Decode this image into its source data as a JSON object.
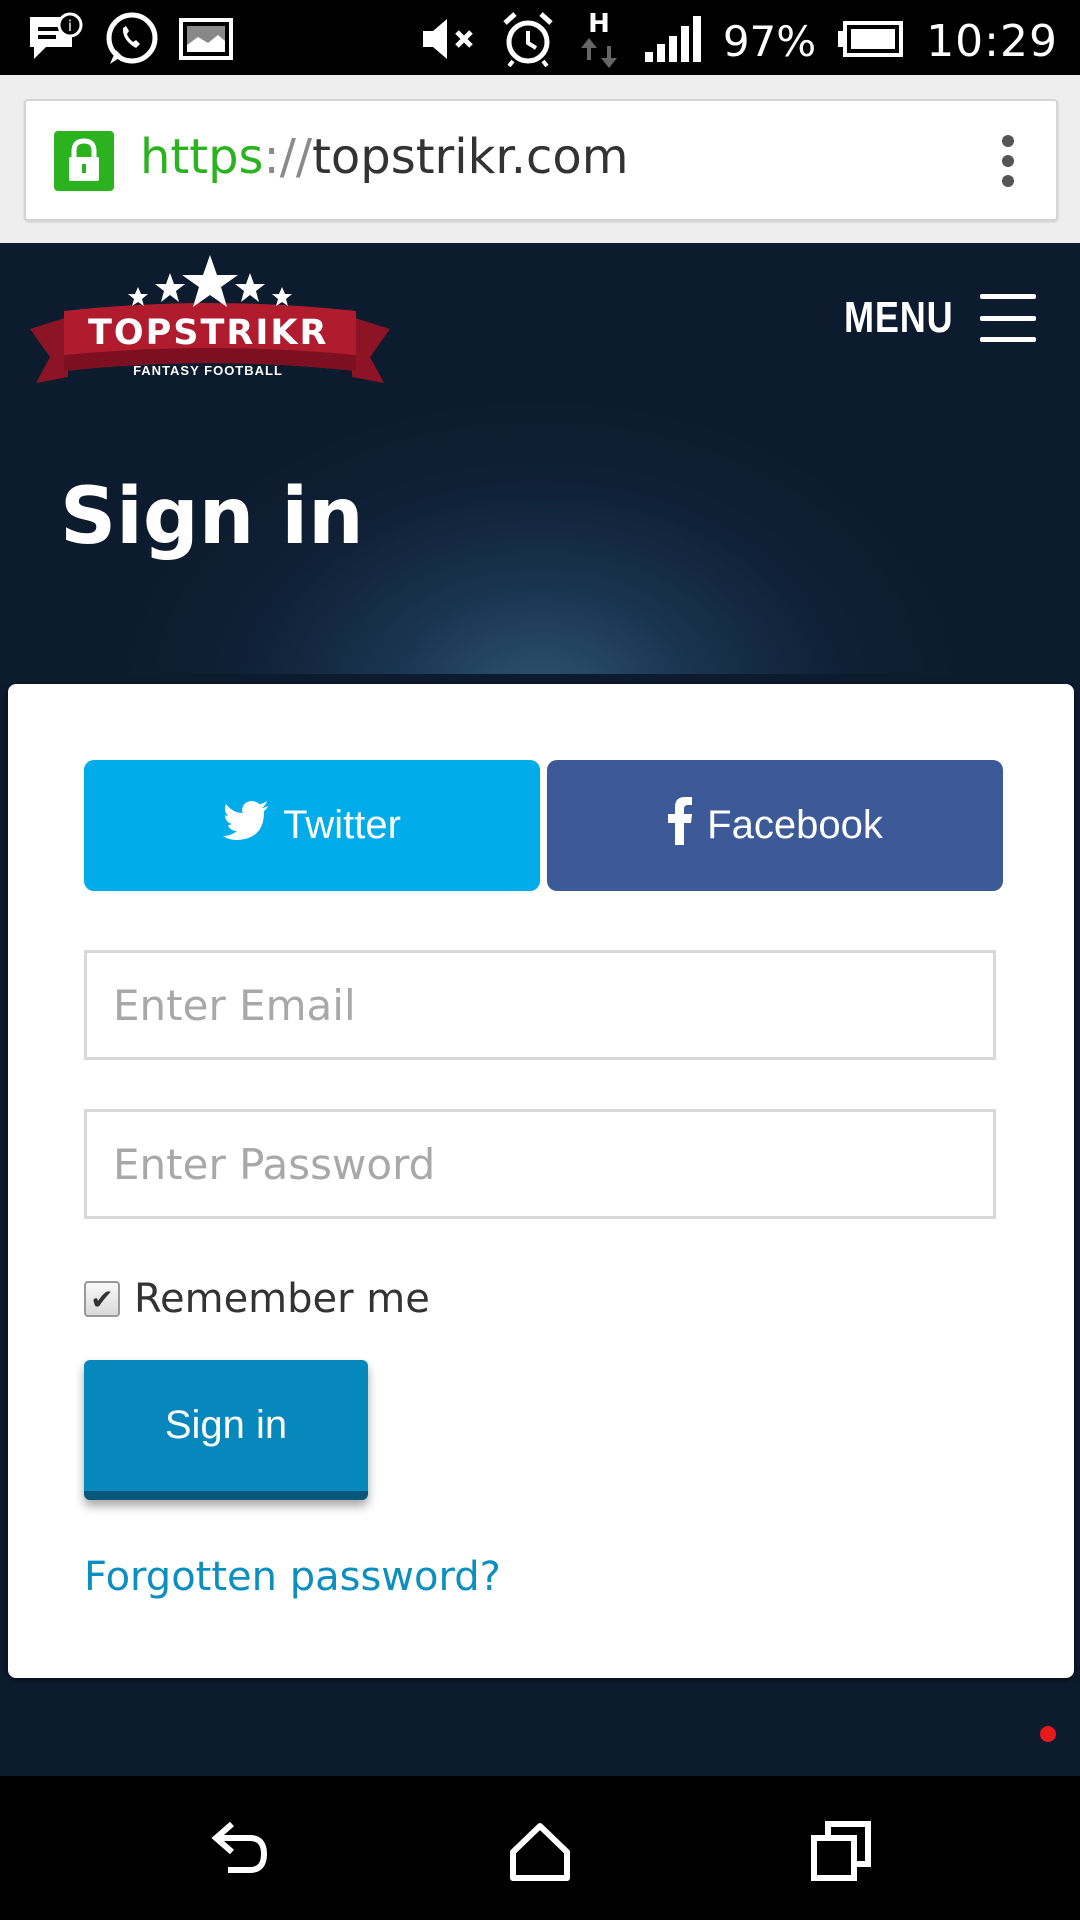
{
  "status_bar": {
    "battery": "97%",
    "time": "10:29",
    "network_type": "H",
    "icons": [
      "messenger-icon",
      "whatsapp-icon",
      "image-icon",
      "mute-icon",
      "alarm-icon",
      "network-icon",
      "signal-icon",
      "battery-icon"
    ]
  },
  "browser": {
    "url_scheme": "https",
    "url_separator": "://",
    "url_host": "topstrikr.com",
    "secure_color": "#2bb31f"
  },
  "header": {
    "logo_text": "TOPSTRIKR",
    "logo_subtitle": "FANTASY FOOTBALL",
    "menu_label": "MENU"
  },
  "hero": {
    "title": "Sign in"
  },
  "form": {
    "twitter_label": "Twitter",
    "facebook_label": "Facebook",
    "email_placeholder": "Enter Email",
    "email_value": "",
    "password_placeholder": "Enter Password",
    "password_value": "",
    "remember_label": "Remember me",
    "remember_checked": true,
    "submit_label": "Sign in",
    "forgot_label": "Forgotten password?"
  },
  "colors": {
    "twitter": "#00acea",
    "facebook": "#3d5a98",
    "primary": "#0788bd",
    "link": "#0b8fc1",
    "header_bg": "#0d1b2e",
    "logo_red": "#b01c2e"
  },
  "nav_bar": {
    "icons": [
      "back-icon",
      "home-icon",
      "recents-icon"
    ]
  }
}
